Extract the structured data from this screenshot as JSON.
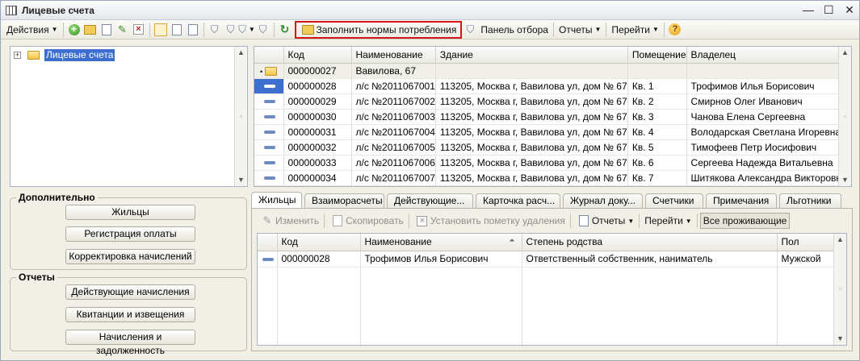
{
  "window": {
    "title": "Лицевые счета",
    "minimize": "—",
    "maximize": "☐",
    "close": "✕"
  },
  "toolbar": {
    "actions": "Действия",
    "fill_norms": "Заполнить нормы потребления",
    "filter_panel": "Панель отбора",
    "reports": "Отчеты",
    "goto": "Перейти"
  },
  "tree": {
    "root_label": "Лицевые счета",
    "toggle": "+"
  },
  "grid": {
    "columns": [
      "Код",
      "Наименование",
      "Здание",
      "Помещение",
      "Владелец"
    ],
    "group_row": {
      "code": "000000027",
      "name": "Вавилова, 67"
    },
    "rows": [
      {
        "code": "000000028",
        "name": "л/с №2011067001",
        "building": "113205, Москва г, Вавилова ул, дом № 67",
        "room": "Кв. 1",
        "owner": "Трофимов Илья Борисович"
      },
      {
        "code": "000000029",
        "name": "л/с №2011067002",
        "building": "113205, Москва г, Вавилова ул, дом № 67",
        "room": "Кв. 2",
        "owner": "Смирнов Олег Иванович"
      },
      {
        "code": "000000030",
        "name": "л/с №2011067003",
        "building": "113205, Москва г, Вавилова ул, дом № 67",
        "room": "Кв. 3",
        "owner": "Чанова Елена Сергеевна"
      },
      {
        "code": "000000031",
        "name": "л/с №2011067004",
        "building": "113205, Москва г, Вавилова ул, дом № 67",
        "room": "Кв. 4",
        "owner": "Володарская Светлана Игоревна"
      },
      {
        "code": "000000032",
        "name": "л/с №2011067005",
        "building": "113205, Москва г, Вавилова ул, дом № 67",
        "room": "Кв. 5",
        "owner": "Тимофеев Петр Иосифович"
      },
      {
        "code": "000000033",
        "name": "л/с №2011067006",
        "building": "113205, Москва г, Вавилова ул, дом № 67",
        "room": "Кв. 6",
        "owner": "Сергеева Надежда Витальевна"
      },
      {
        "code": "000000034",
        "name": "л/с №2011067007",
        "building": "113205, Москва г, Вавилова ул, дом № 67",
        "room": "Кв. 7",
        "owner": "Шитякова Александра Викторовна"
      }
    ]
  },
  "additional": {
    "title": "Дополнительно",
    "buttons": [
      "Жильцы",
      "Регистрация оплаты",
      "Корректировка начислений"
    ]
  },
  "reports_group": {
    "title": "Отчеты",
    "buttons": [
      "Действующие начисления",
      "Квитанции и извещения",
      "Начисления и задолженность"
    ]
  },
  "tabs": [
    "Жильцы",
    "Взаиморасчеты",
    "Действующие...",
    "Карточка расч...",
    "Журнал доку...",
    "Счетчики",
    "Примечания",
    "Льготники"
  ],
  "subtoolbar": {
    "edit": "Изменить",
    "copy": "Скопировать",
    "mark_delete": "Установить пометку удаления",
    "reports": "Отчеты",
    "goto": "Перейти",
    "all_residents": "Все проживающие"
  },
  "subgrid": {
    "columns": [
      "Код",
      "Наименование",
      "Степень родства",
      "Пол"
    ],
    "rows": [
      {
        "code": "000000028",
        "name": "Трофимов Илья Борисович",
        "relation": "Ответственный собственник, наниматель",
        "sex": "Мужской"
      }
    ]
  }
}
